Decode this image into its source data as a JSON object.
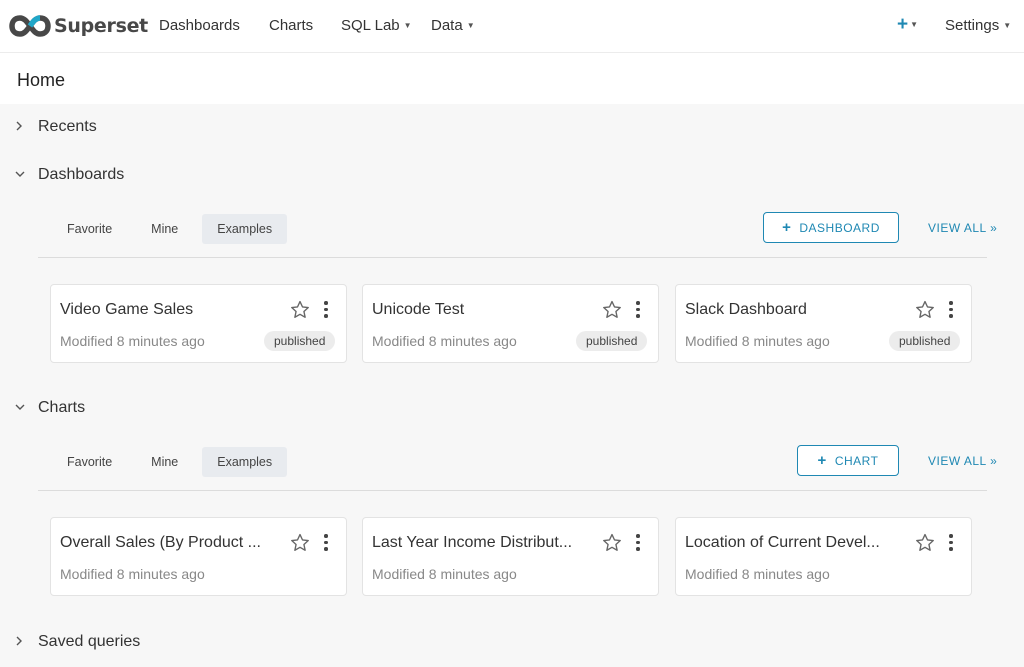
{
  "brand": {
    "name": "Superset"
  },
  "nav": {
    "items": [
      {
        "label": "Dashboards"
      },
      {
        "label": "Charts"
      },
      {
        "label": "SQL Lab"
      },
      {
        "label": "Data"
      }
    ],
    "plus_label": "+",
    "settings_label": "Settings"
  },
  "page": {
    "title": "Home"
  },
  "recents": {
    "label": "Recents"
  },
  "dashboards": {
    "label": "Dashboards",
    "tabs": [
      "Favorite",
      "Mine",
      "Examples"
    ],
    "active_tab": "Examples",
    "add_label": "DASHBOARD",
    "view_all_label": "VIEW ALL »",
    "cards": [
      {
        "title": "Video Game Sales",
        "modified": "Modified 8 minutes ago",
        "status": "published"
      },
      {
        "title": "Unicode Test",
        "modified": "Modified 8 minutes ago",
        "status": "published"
      },
      {
        "title": "Slack Dashboard",
        "modified": "Modified 8 minutes ago",
        "status": "published"
      }
    ]
  },
  "charts": {
    "label": "Charts",
    "tabs": [
      "Favorite",
      "Mine",
      "Examples"
    ],
    "active_tab": "Examples",
    "add_label": "CHART",
    "view_all_label": "VIEW ALL »",
    "cards": [
      {
        "title": "Overall Sales (By Product ...",
        "modified": "Modified 8 minutes ago"
      },
      {
        "title": "Last Year Income Distribut...",
        "modified": "Modified 8 minutes ago"
      },
      {
        "title": "Location of Current Devel...",
        "modified": "Modified 8 minutes ago"
      }
    ]
  },
  "saved_queries": {
    "label": "Saved queries"
  },
  "colors": {
    "accent": "#1f88b3",
    "background": "#f7f7f7"
  },
  "icons": {
    "collapsed": "chevron-right-icon",
    "expanded": "chevron-down-icon",
    "favorite": "star-icon",
    "more": "kebab-icon"
  }
}
